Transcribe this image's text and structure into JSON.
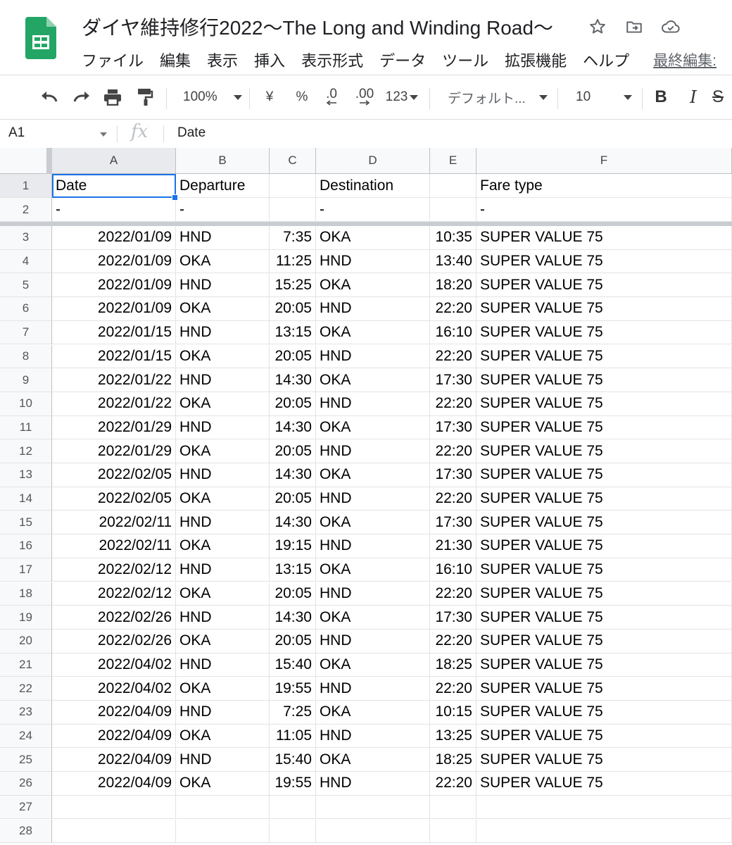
{
  "doc": {
    "title": "ダイヤ維持修行2022〜The Long and Winding Road〜",
    "icons": [
      "star-icon",
      "move-to-folder-icon",
      "cloud-saved-icon"
    ]
  },
  "menu": {
    "items": [
      "ファイル",
      "編集",
      "表示",
      "挿入",
      "表示形式",
      "データ",
      "ツール",
      "拡張機能",
      "ヘルプ"
    ],
    "last_edit": "最終編集:"
  },
  "toolbar": {
    "zoom": "100%",
    "currency": "¥",
    "percent": "%",
    "decrease_decimal": ".0",
    "increase_decimal": ".00",
    "more_formats": "123",
    "font": "デフォルト...",
    "font_size": "10",
    "bold": "B",
    "italic": "I",
    "strikethrough": "S"
  },
  "formula_bar": {
    "name_box": "A1",
    "fx": "fx",
    "value": "Date"
  },
  "sheet": {
    "columns": [
      "A",
      "B",
      "C",
      "D",
      "E",
      "F"
    ],
    "row_numbers": [
      "1",
      "2",
      "3",
      "4",
      "5",
      "6",
      "7",
      "8",
      "9",
      "10",
      "11",
      "12",
      "13",
      "14",
      "15",
      "16",
      "17",
      "18",
      "19",
      "20",
      "21",
      "22",
      "23",
      "24",
      "25",
      "26",
      "27",
      "28"
    ],
    "rows": [
      [
        "Date",
        "Departure",
        "",
        "Destination",
        "",
        "Fare type"
      ],
      [
        "-",
        "-",
        "",
        "-",
        "",
        "-"
      ],
      [
        "2022/01/09",
        "HND",
        "7:35",
        "OKA",
        "10:35",
        "SUPER VALUE 75"
      ],
      [
        "2022/01/09",
        "OKA",
        "11:25",
        "HND",
        "13:40",
        "SUPER VALUE 75"
      ],
      [
        "2022/01/09",
        "HND",
        "15:25",
        "OKA",
        "18:20",
        "SUPER VALUE 75"
      ],
      [
        "2022/01/09",
        "OKA",
        "20:05",
        "HND",
        "22:20",
        "SUPER VALUE 75"
      ],
      [
        "2022/01/15",
        "HND",
        "13:15",
        "OKA",
        "16:10",
        "SUPER VALUE 75"
      ],
      [
        "2022/01/15",
        "OKA",
        "20:05",
        "HND",
        "22:20",
        "SUPER VALUE 75"
      ],
      [
        "2022/01/22",
        "HND",
        "14:30",
        "OKA",
        "17:30",
        "SUPER VALUE 75"
      ],
      [
        "2022/01/22",
        "OKA",
        "20:05",
        "HND",
        "22:20",
        "SUPER VALUE 75"
      ],
      [
        "2022/01/29",
        "HND",
        "14:30",
        "OKA",
        "17:30",
        "SUPER VALUE 75"
      ],
      [
        "2022/01/29",
        "OKA",
        "20:05",
        "HND",
        "22:20",
        "SUPER VALUE 75"
      ],
      [
        "2022/02/05",
        "HND",
        "14:30",
        "OKA",
        "17:30",
        "SUPER VALUE 75"
      ],
      [
        "2022/02/05",
        "OKA",
        "20:05",
        "HND",
        "22:20",
        "SUPER VALUE 75"
      ],
      [
        "2022/02/11",
        "HND",
        "14:30",
        "OKA",
        "17:30",
        "SUPER VALUE 75"
      ],
      [
        "2022/02/11",
        "OKA",
        "19:15",
        "HND",
        "21:30",
        "SUPER VALUE 75"
      ],
      [
        "2022/02/12",
        "HND",
        "13:15",
        "OKA",
        "16:10",
        "SUPER VALUE 75"
      ],
      [
        "2022/02/12",
        "OKA",
        "20:05",
        "HND",
        "22:20",
        "SUPER VALUE 75"
      ],
      [
        "2022/02/26",
        "HND",
        "14:30",
        "OKA",
        "17:30",
        "SUPER VALUE 75"
      ],
      [
        "2022/02/26",
        "OKA",
        "20:05",
        "HND",
        "22:20",
        "SUPER VALUE 75"
      ],
      [
        "2022/04/02",
        "HND",
        "15:40",
        "OKA",
        "18:25",
        "SUPER VALUE 75"
      ],
      [
        "2022/04/02",
        "OKA",
        "19:55",
        "HND",
        "22:20",
        "SUPER VALUE 75"
      ],
      [
        "2022/04/09",
        "HND",
        "7:25",
        "OKA",
        "10:15",
        "SUPER VALUE 75"
      ],
      [
        "2022/04/09",
        "OKA",
        "11:05",
        "HND",
        "13:25",
        "SUPER VALUE 75"
      ],
      [
        "2022/04/09",
        "HND",
        "15:40",
        "OKA",
        "18:25",
        "SUPER VALUE 75"
      ],
      [
        "2022/04/09",
        "OKA",
        "19:55",
        "HND",
        "22:20",
        "SUPER VALUE 75"
      ],
      [
        "",
        "",
        "",
        "",
        "",
        ""
      ],
      [
        "",
        "",
        "",
        "",
        "",
        ""
      ]
    ],
    "selected_cell": "A1"
  }
}
